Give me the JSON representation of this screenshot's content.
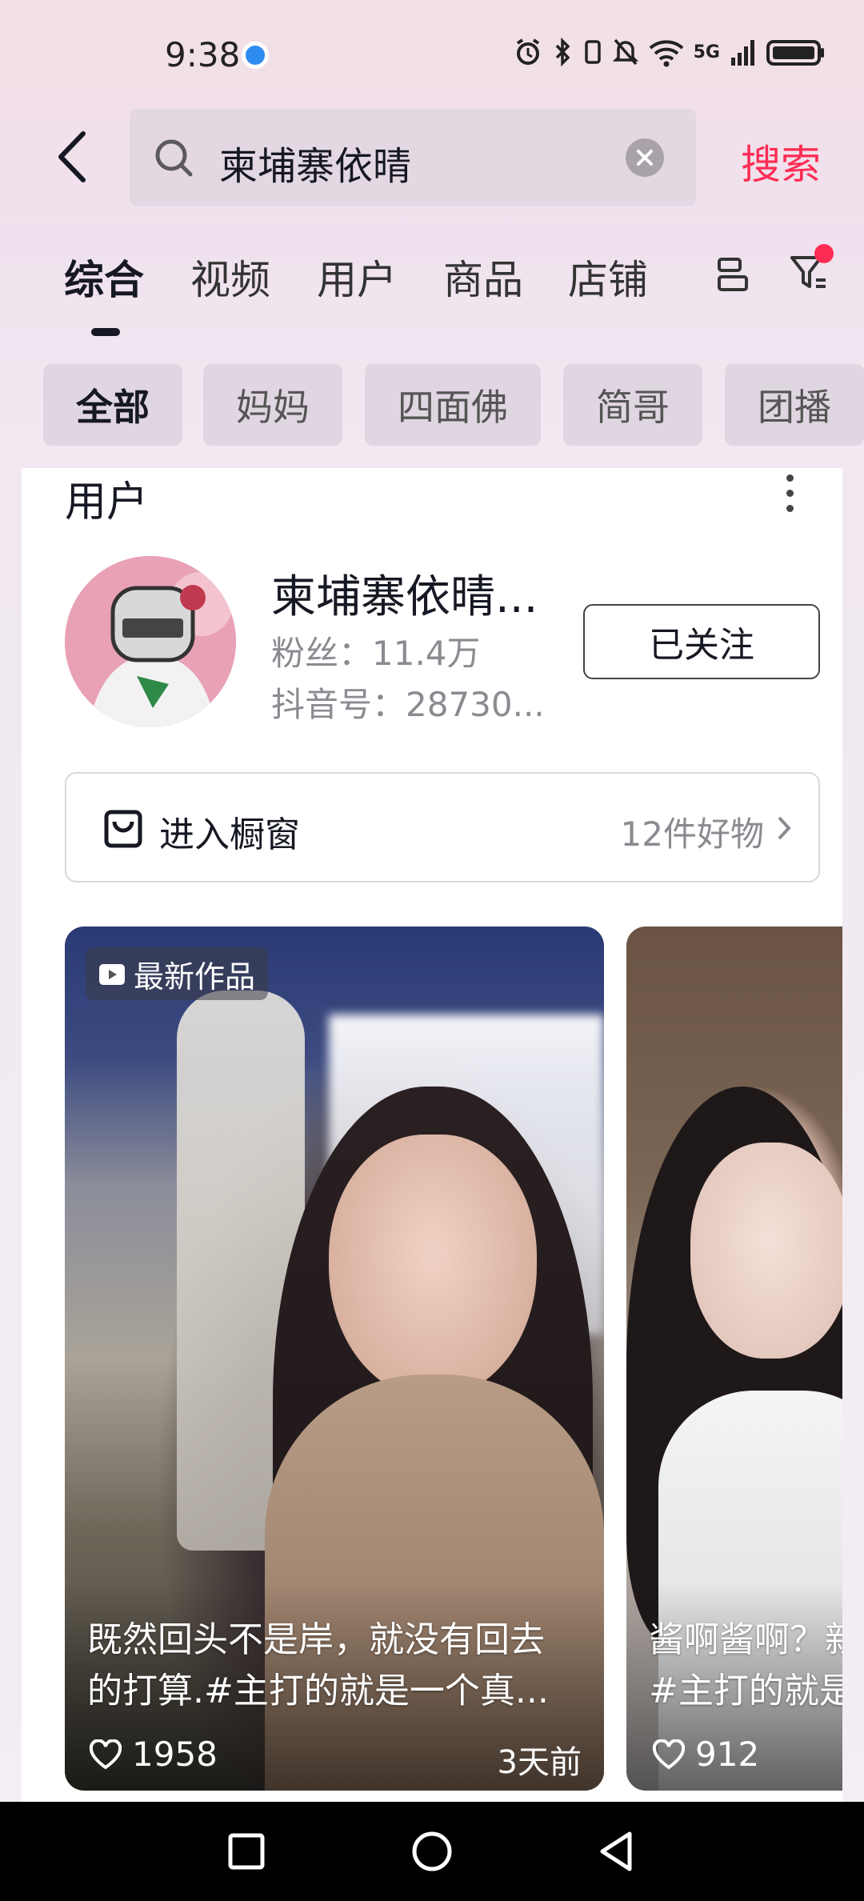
{
  "status_bar": {
    "time": "9:38",
    "network": "5G"
  },
  "search": {
    "query": "柬埔寨依晴",
    "submit_label": "搜索"
  },
  "tabs": [
    {
      "label": "综合",
      "active": true
    },
    {
      "label": "视频",
      "active": false
    },
    {
      "label": "用户",
      "active": false
    },
    {
      "label": "商品",
      "active": false
    },
    {
      "label": "店铺",
      "active": false
    }
  ],
  "chips": [
    {
      "label": "全部",
      "active": true
    },
    {
      "label": "妈妈",
      "active": false
    },
    {
      "label": "四面佛",
      "active": false
    },
    {
      "label": "简哥",
      "active": false
    },
    {
      "label": "团播",
      "active": false
    }
  ],
  "user_section": {
    "title": "用户",
    "name": "柬埔寨依晴...",
    "fans": "粉丝：11.4万",
    "douyin_id": "抖音号：28730...",
    "follow_label": "已关注"
  },
  "showcase": {
    "label": "进入橱窗",
    "count": "12件好物"
  },
  "videos": [
    {
      "badge": "最新作品",
      "caption_line1": "既然回头不是岸，就没有回去",
      "caption_line2": "的打算.#主打的就是一个真...",
      "likes": "1958",
      "time": "3天前"
    },
    {
      "caption_line1": "酱啊酱啊？新",
      "caption_line2": "#主打的就是",
      "likes": "912"
    }
  ],
  "colors": {
    "accent": "#fe2c55",
    "text_primary": "#161823",
    "text_secondary": "#8a8b91"
  }
}
